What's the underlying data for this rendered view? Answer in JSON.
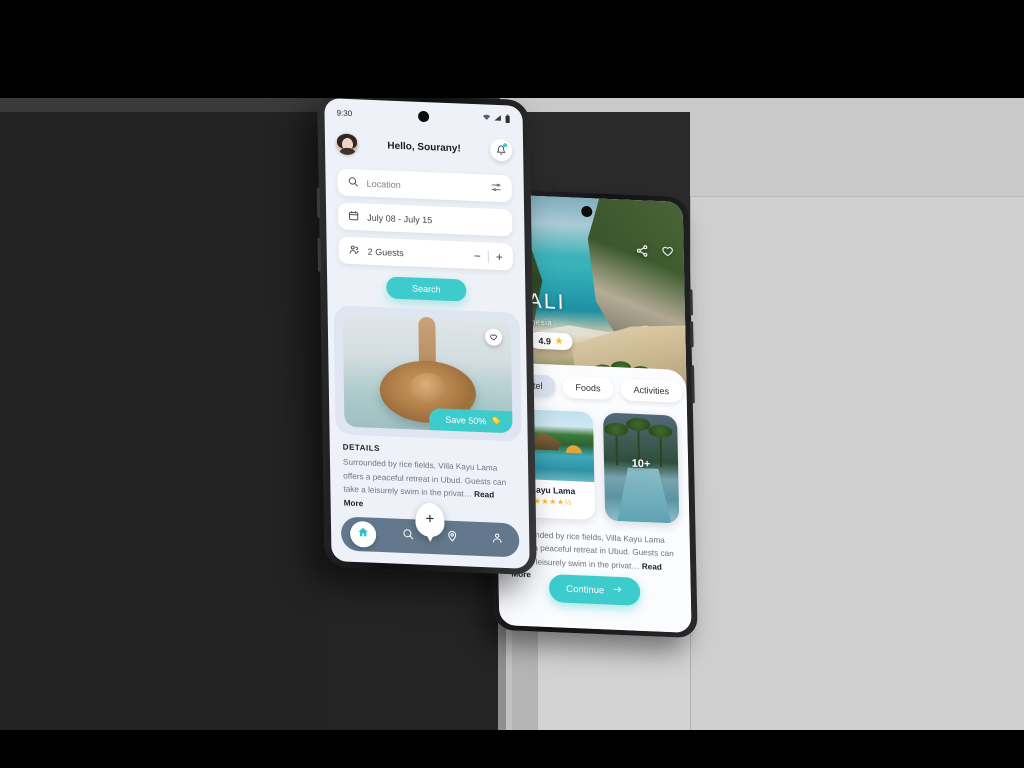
{
  "scene": {
    "title": "Travel booking app mockup — two phone mockups",
    "accent_color": "#3ECBCB",
    "background_dark": "#232323",
    "background_light": "#C9C9C9"
  },
  "front_phone": {
    "status_bar": {
      "time": "9:30",
      "icons": [
        "wifi-icon",
        "signal-icon",
        "battery-icon"
      ]
    },
    "header": {
      "greeting": "Hello, Sourany!",
      "avatar_alt": "user-avatar",
      "bell_label": "notification-bell"
    },
    "search_form": {
      "location": {
        "placeholder": "Location",
        "value": "",
        "icon": "search-icon",
        "filter_icon": "filter-sliders-icon"
      },
      "dates": {
        "value": "July 08 - July 15",
        "icon": "calendar-icon"
      },
      "guests": {
        "value": "2 Guests",
        "icon": "guests-icon",
        "decrement": "−",
        "increment": "+"
      },
      "submit_label": "Search"
    },
    "promo_card": {
      "badge_label": "Save 50%",
      "badge_icon": "price-tag-icon",
      "favorite_icon": "heart-outline-icon",
      "image_alt": "woman-in-straw-hat-at-beach"
    },
    "details": {
      "heading": "DETAILS",
      "body": "Surrounded by rice fields, Villa Kayu Lama offers a peaceful retreat in Ubud. Guests can take a leisurely swim in the privat… ",
      "read_more": "Read More"
    },
    "bottom_nav": {
      "items": [
        {
          "name": "home",
          "icon": "home-icon",
          "active": true
        },
        {
          "name": "search",
          "icon": "search-icon",
          "active": false
        },
        {
          "name": "location",
          "icon": "map-pin-icon",
          "active": false
        },
        {
          "name": "profile",
          "icon": "person-icon",
          "active": false
        }
      ],
      "fab_label": "+",
      "fab_icon": "plus-icon"
    }
  },
  "back_phone": {
    "hero": {
      "title": "BALI",
      "subtitle": "Indonesia",
      "rating": "4.9",
      "rating_star": "★",
      "share_icon": "share-icon",
      "favorite_icon": "heart-outline-icon",
      "image_alt": "bali-cliff-beach-aerial"
    },
    "tabs": [
      {
        "label": "Hotel",
        "active": true
      },
      {
        "label": "Foods",
        "active": false
      },
      {
        "label": "Activities",
        "active": false
      }
    ],
    "cards": [
      {
        "title": "Villa Kayu Lama",
        "short_title": "Kayu Lama",
        "stars": "★★★★½",
        "image_alt": "villa-pool-with-huts"
      },
      {
        "badge": "10+",
        "image_alt": "resort-pool-with-palms"
      }
    ],
    "description": {
      "body": "Surrounded by rice fields, Villa Kayu Lama offers a peaceful retreat in Ubud. Guests can take a leisurely swim in the privat… ",
      "read_more": "Read More"
    },
    "cta": {
      "label": "Continue",
      "icon": "arrow-right-icon"
    }
  }
}
